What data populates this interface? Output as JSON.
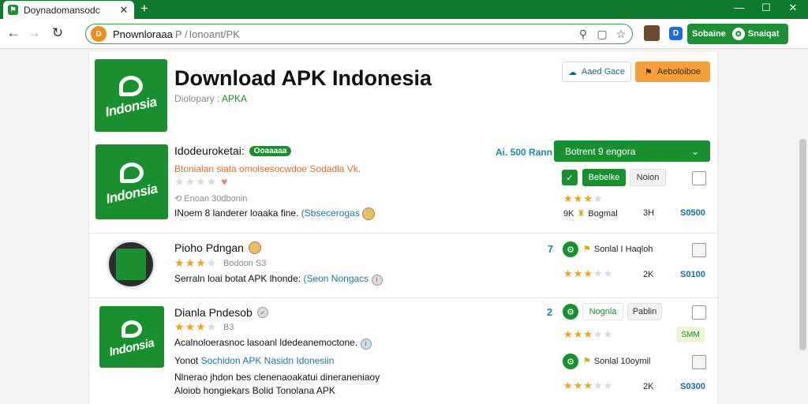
{
  "browser": {
    "tab_title": "Doynadomansodc",
    "tab_close": "✕",
    "new_tab": "+",
    "window_controls": [
      "—",
      "☐",
      "✕"
    ],
    "nav": {
      "back": "←",
      "forward": "→",
      "reload": "↻"
    },
    "address": {
      "site_badge": "D",
      "domain": "Pnownloraaa",
      "separator": "P /",
      "path": "Ionoant/PK"
    },
    "omnibox_icons": {
      "search": "⚲",
      "reader": "▢",
      "bookmark": "☆"
    },
    "extension_label": "D",
    "account": {
      "left": "Sobaine",
      "avatar": "✪",
      "right": "Snaiqat"
    }
  },
  "header": {
    "logo_text": "Indonsia",
    "title": "Download APK Indonesia",
    "subtitle_label": "Diolopary :",
    "subtitle_accent": "APKA",
    "btn_ghost": {
      "icon": "☁",
      "label": "Aaed Gace"
    },
    "btn_orange": {
      "icon": "⚑",
      "label": "Aeboloiboe"
    }
  },
  "rows": [
    {
      "logo_text": "Indonsia",
      "name": "Idodeuroketai:",
      "tag": "Ooaaaaa",
      "desc": "Btonialan siata omolsesocwdoe Sodadla Vk.",
      "stars": 0,
      "meta": "Enoan 30dbonin",
      "line": "INoem 8 landerer loaaka fine.",
      "link": "(Sbsecerogas",
      "count": "Ai. 500 Rann",
      "download_select": "Botrent 9 engora",
      "download_chevron": "⌄",
      "action_green": "Bebelke",
      "action_grey": "Noion",
      "right_stars": 3,
      "right_num": "9K",
      "right_label": "Bogmal",
      "right_num2": "3H",
      "size": "S0500"
    },
    {
      "name": "Pioho Pdngan",
      "stars": 3,
      "meta": "Bodoon S3",
      "line": "Serraln loai botat APK lhonde:",
      "link": "(Seon Nongacs",
      "count": "7",
      "mini_label": "Sonlal I Haqloh",
      "right_stars": 3,
      "right_num": "2K",
      "size": "S0100"
    },
    {
      "logo_text": "Indonsia",
      "name": "Dianla Pndesob",
      "stars": 3,
      "meta": "B3",
      "line": "Acalnoloerasnoc lasoanl ldedeanemoctone.",
      "line2_prefix": "Yonot",
      "line2_link": "Sochidon APK Nasidn Idonesiin",
      "line3": "Nlnerao jhdon bes clenenaoakatui dineraneniaoy",
      "line4": "Aloiob hongiekars Bolid Tonolana APK",
      "count": "2",
      "action_green_text": "Nognla",
      "action_grey": "Pablin",
      "beige_label": "SMM",
      "mini_label": "Sonlal 10oymil",
      "right_stars_a": 3,
      "right_stars_b": 3,
      "right_num": "2K",
      "size": "S0300"
    }
  ]
}
